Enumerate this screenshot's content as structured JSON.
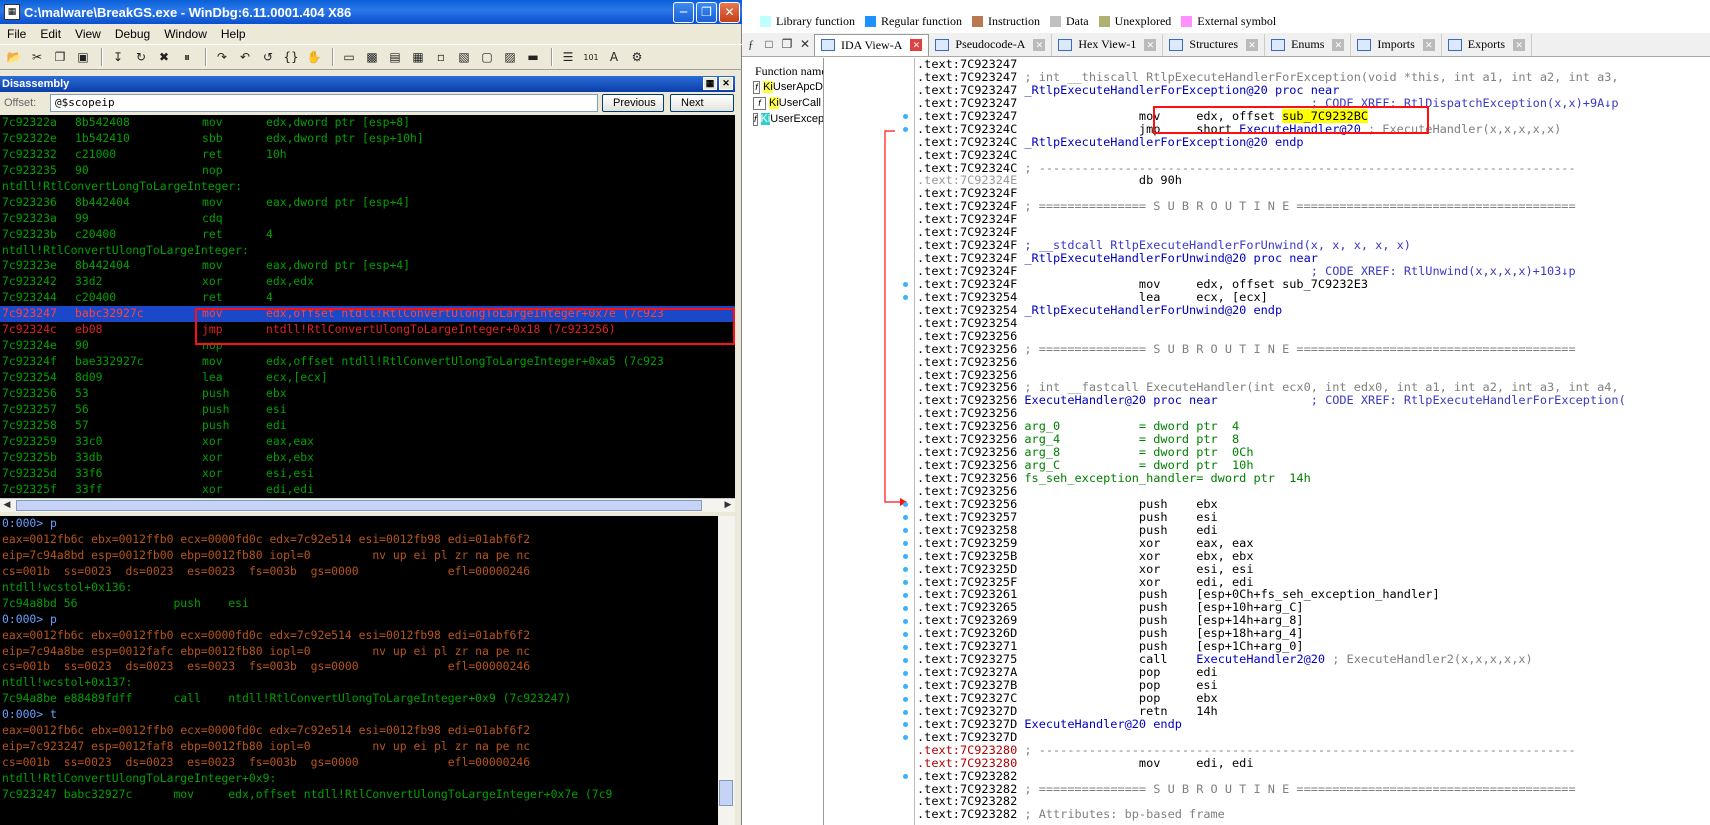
{
  "windbg": {
    "title": "C:\\malware\\BreakGS.exe - WinDbg:6.11.0001.404 X86",
    "menu": [
      "File",
      "Edit",
      "View",
      "Debug",
      "Window",
      "Help"
    ],
    "pane_title": "Disassembly",
    "offset_label": "Offset:",
    "offset_value": "@$scopeip",
    "previous_label": "Previous",
    "next_label": "Next",
    "disasm": [
      {
        "addr": "7c92322a",
        "bytes": "8b542408",
        "op": "mov",
        "args": "edx,dword ptr [esp+8]"
      },
      {
        "addr": "7c92322e",
        "bytes": "1b542410",
        "op": "sbb",
        "args": "edx,dword ptr [esp+10h]"
      },
      {
        "addr": "7c923232",
        "bytes": "c21000",
        "op": "ret",
        "args": "10h"
      },
      {
        "addr": "7c923235",
        "bytes": "90",
        "op": "nop",
        "args": ""
      },
      {
        "label": "ntdll!RtlConvertLongToLargeInteger:"
      },
      {
        "addr": "7c923236",
        "bytes": "8b442404",
        "op": "mov",
        "args": "eax,dword ptr [esp+4]"
      },
      {
        "addr": "7c92323a",
        "bytes": "99",
        "op": "cdq",
        "args": ""
      },
      {
        "addr": "7c92323b",
        "bytes": "c20400",
        "op": "ret",
        "args": "4"
      },
      {
        "label": "ntdll!RtlConvertUlongToLargeInteger:"
      },
      {
        "addr": "7c92323e",
        "bytes": "8b442404",
        "op": "mov",
        "args": "eax,dword ptr [esp+4]"
      },
      {
        "addr": "7c923242",
        "bytes": "33d2",
        "op": "xor",
        "args": "edx,edx"
      },
      {
        "addr": "7c923244",
        "bytes": "c20400",
        "op": "ret",
        "args": "4"
      },
      {
        "addr": "7c923247",
        "bytes": "babc32927c",
        "op": "mov",
        "args": "edx,offset ntdll!RtlConvertUlongToLargeInteger+0x7e (7c923",
        "style": "hl"
      },
      {
        "addr": "7c92324c",
        "bytes": "eb08",
        "op": "jmp",
        "args": "ntdll!RtlConvertUlongToLargeInteger+0x18 (7c923256)",
        "style": "sel"
      },
      {
        "addr": "7c92324e",
        "bytes": "90",
        "op": "nop",
        "args": ""
      },
      {
        "addr": "7c92324f",
        "bytes": "bae332927c",
        "op": "mov",
        "args": "edx,offset ntdll!RtlConvertUlongToLargeInteger+0xa5 (7c923"
      },
      {
        "addr": "7c923254",
        "bytes": "8d09",
        "op": "lea",
        "args": "ecx,[ecx]"
      },
      {
        "addr": "7c923256",
        "bytes": "53",
        "op": "push",
        "args": "ebx"
      },
      {
        "addr": "7c923257",
        "bytes": "56",
        "op": "push",
        "args": "esi"
      },
      {
        "addr": "7c923258",
        "bytes": "57",
        "op": "push",
        "args": "edi"
      },
      {
        "addr": "7c923259",
        "bytes": "33c0",
        "op": "xor",
        "args": "eax,eax"
      },
      {
        "addr": "7c92325b",
        "bytes": "33db",
        "op": "xor",
        "args": "ebx,ebx"
      },
      {
        "addr": "7c92325d",
        "bytes": "33f6",
        "op": "xor",
        "args": "esi,esi"
      },
      {
        "addr": "7c92325f",
        "bytes": "33ff",
        "op": "xor",
        "args": "edi,edi"
      }
    ],
    "command": [
      {
        "t": "0:000> p",
        "s": "prompt"
      },
      {
        "t": "eax=0012fb6c ebx=0012ffb0 ecx=0000fd0c edx=7c92e514 esi=0012fb98 edi=01abf6f2"
      },
      {
        "t": "eip=7c94a8bd esp=0012fb00 ebp=0012fb80 iopl=0         nv up ei pl zr na pe nc"
      },
      {
        "t": "cs=001b  ss=0023  ds=0023  es=0023  fs=003b  gs=0000             efl=00000246"
      },
      {
        "t": "ntdll!wcstol+0x136:",
        "s": "g"
      },
      {
        "t": "7c94a8bd 56              push    esi",
        "s": "g"
      },
      {
        "t": "0:000> p",
        "s": "prompt"
      },
      {
        "t": "eax=0012fb6c ebx=0012ffb0 ecx=0000fd0c edx=7c92e514 esi=0012fb98 edi=01abf6f2"
      },
      {
        "t": "eip=7c94a8be esp=0012fafc ebp=0012fb80 iopl=0         nv up ei pl zr na pe nc"
      },
      {
        "t": "cs=001b  ss=0023  ds=0023  es=0023  fs=003b  gs=0000             efl=00000246"
      },
      {
        "t": "ntdll!wcstol+0x137:",
        "s": "g"
      },
      {
        "t": "7c94a8be e88489fdff      call    ntdll!RtlConvertUlongToLargeInteger+0x9 (7c923247)",
        "s": "g"
      },
      {
        "t": "0:000> t",
        "s": "prompt"
      },
      {
        "t": "eax=0012fb6c ebx=0012ffb0 ecx=0000fd0c edx=7c92e514 esi=0012fb98 edi=01abf6f2"
      },
      {
        "t": "eip=7c923247 esp=0012faf8 ebp=0012fb80 iopl=0         nv up ei pl zr na pe nc"
      },
      {
        "t": "cs=001b  ss=0023  ds=0023  es=0023  fs=003b  gs=0000             efl=00000246"
      },
      {
        "t": "ntdll!RtlConvertUlongToLargeInteger+0x9:",
        "s": "g"
      },
      {
        "t": "7c923247 babc32927c      mov     edx,offset ntdll!RtlConvertUlongToLargeInteger+0x7e (7c9",
        "s": "g"
      }
    ]
  },
  "ida": {
    "legend": [
      {
        "label": "Library function",
        "color": "#c0ffff"
      },
      {
        "label": "Regular function",
        "color": "#1e90ff"
      },
      {
        "label": "Instruction",
        "color": "#b87850"
      },
      {
        "label": "Data",
        "color": "#c0c0c0"
      },
      {
        "label": "Unexplored",
        "color": "#b0b070"
      },
      {
        "label": "External symbol",
        "color": "#ff90ff"
      }
    ],
    "tabs": [
      "IDA View-A",
      "Pseudocode-A",
      "Hex View-1",
      "Structures",
      "Enums",
      "Imports",
      "Exports"
    ],
    "function_header": "Function name",
    "functions": [
      {
        "prefix": "Ki",
        "rest": "UserApcD"
      },
      {
        "prefix": "Ki",
        "rest": "UserCall"
      },
      {
        "prefix": "Ki",
        "rest": "UserExcep"
      }
    ],
    "lines": [
      {
        "a": ".text:7C923247",
        "p": []
      },
      {
        "a": ".text:7C923247",
        "p": [
          {
            "c": "cmt",
            "t": " ; int __thiscall RtlpExecuteHandlerForException(void *this, int a1, int a2, int a3,"
          }
        ]
      },
      {
        "a": ".text:7C923247",
        "p": [
          {
            "c": "fnm",
            "t": " _RtlpExecuteHandlerForException@20 proc near"
          }
        ]
      },
      {
        "a": ".text:7C923247",
        "p": [
          {
            "c": "",
            "t": "                                         "
          },
          {
            "c": "cmtb",
            "t": "; CODE XREF: RtlDispatchException(x,x)+9A↓p"
          }
        ]
      },
      {
        "a": ".text:7C923247",
        "p": [
          {
            "c": "",
            "t": "                 mov     edx, offset "
          },
          {
            "c": "yl",
            "t": "sub_7C9232BC"
          }
        ]
      },
      {
        "a": ".text:7C92324C",
        "p": [
          {
            "c": "",
            "t": "                 jmp     short "
          },
          {
            "c": "fnm",
            "t": "ExecuteHandler@20"
          },
          {
            "c": "cmt",
            "t": " ; ExecuteHandler(x,x,x,x,x)"
          }
        ]
      },
      {
        "a": ".text:7C92324C",
        "p": [
          {
            "c": "fnm",
            "t": " _RtlpExecuteHandlerForException@20 endp"
          }
        ]
      },
      {
        "a": ".text:7C92324C",
        "p": []
      },
      {
        "a": ".text:7C92324C",
        "p": [
          {
            "c": "sep",
            "t": " ; ---------------------------------------------------------------------------"
          }
        ]
      },
      {
        "a": ".text:7C92324E",
        "s": "gray",
        "p": [
          {
            "c": "",
            "t": "                 db 90h"
          }
        ]
      },
      {
        "a": ".text:7C92324F",
        "p": []
      },
      {
        "a": ".text:7C92324F",
        "p": [
          {
            "c": "sep",
            "t": " ; =============== S U B R O U T I N E ======================================="
          }
        ]
      },
      {
        "a": ".text:7C92324F",
        "p": []
      },
      {
        "a": ".text:7C92324F",
        "p": []
      },
      {
        "a": ".text:7C92324F",
        "p": [
          {
            "c": "cmtb",
            "t": " ; __stdcall RtlpExecuteHandlerForUnwind(x, x, x, x, x)"
          }
        ]
      },
      {
        "a": ".text:7C92324F",
        "p": [
          {
            "c": "fnm",
            "t": " _RtlpExecuteHandlerForUnwind@20 proc near"
          }
        ]
      },
      {
        "a": ".text:7C92324F",
        "p": [
          {
            "c": "",
            "t": "                                         "
          },
          {
            "c": "cmtb",
            "t": "; CODE XREF: RtlUnwind(x,x,x,x)+103↓p"
          }
        ]
      },
      {
        "a": ".text:7C92324F",
        "p": [
          {
            "c": "",
            "t": "                 mov     edx, offset sub_7C9232E3"
          }
        ]
      },
      {
        "a": ".text:7C923254",
        "p": [
          {
            "c": "",
            "t": "                 lea     ecx, [ecx]"
          }
        ]
      },
      {
        "a": ".text:7C923254",
        "p": [
          {
            "c": "fnm",
            "t": " _RtlpExecuteHandlerForUnwind@20 endp"
          }
        ]
      },
      {
        "a": ".text:7C923254",
        "p": []
      },
      {
        "a": ".text:7C923256",
        "p": []
      },
      {
        "a": ".text:7C923256",
        "p": [
          {
            "c": "sep",
            "t": " ; =============== S U B R O U T I N E ======================================="
          }
        ]
      },
      {
        "a": ".text:7C923256",
        "p": []
      },
      {
        "a": ".text:7C923256",
        "p": []
      },
      {
        "a": ".text:7C923256",
        "p": [
          {
            "c": "cmt",
            "t": " ; int __fastcall ExecuteHandler(int ecx0, int edx0, int a1, int a2, int a3, int a4,"
          }
        ]
      },
      {
        "a": ".text:7C923256",
        "p": [
          {
            "c": "fnm",
            "t": " ExecuteHandler@20 proc near"
          },
          {
            "c": "",
            "t": "             "
          },
          {
            "c": "cmtb",
            "t": "; CODE XREF: RtlpExecuteHandlerForException("
          }
        ]
      },
      {
        "a": ".text:7C923256",
        "p": []
      },
      {
        "a": ".text:7C923256",
        "p": [
          {
            "c": "grn",
            "t": " arg_0           = dword ptr  4"
          }
        ]
      },
      {
        "a": ".text:7C923256",
        "p": [
          {
            "c": "grn",
            "t": " arg_4           = dword ptr  8"
          }
        ]
      },
      {
        "a": ".text:7C923256",
        "p": [
          {
            "c": "grn",
            "t": " arg_8           = dword ptr  0Ch"
          }
        ]
      },
      {
        "a": ".text:7C923256",
        "p": [
          {
            "c": "grn",
            "t": " arg_C           = dword ptr  10h"
          }
        ]
      },
      {
        "a": ".text:7C923256",
        "p": [
          {
            "c": "grn",
            "t": " fs_seh_exception_handler= dword ptr  14h"
          }
        ]
      },
      {
        "a": ".text:7C923256",
        "p": []
      },
      {
        "a": ".text:7C923256",
        "p": [
          {
            "c": "",
            "t": "                 push    ebx"
          }
        ]
      },
      {
        "a": ".text:7C923257",
        "p": [
          {
            "c": "",
            "t": "                 push    esi"
          }
        ]
      },
      {
        "a": ".text:7C923258",
        "p": [
          {
            "c": "",
            "t": "                 push    edi"
          }
        ]
      },
      {
        "a": ".text:7C923259",
        "p": [
          {
            "c": "",
            "t": "                 xor     eax, eax"
          }
        ]
      },
      {
        "a": ".text:7C92325B",
        "p": [
          {
            "c": "",
            "t": "                 xor     ebx, ebx"
          }
        ]
      },
      {
        "a": ".text:7C92325D",
        "p": [
          {
            "c": "",
            "t": "                 xor     esi, esi"
          }
        ]
      },
      {
        "a": ".text:7C92325F",
        "p": [
          {
            "c": "",
            "t": "                 xor     edi, edi"
          }
        ]
      },
      {
        "a": ".text:7C923261",
        "p": [
          {
            "c": "",
            "t": "                 push    [esp+0Ch+fs_seh_exception_handler]"
          }
        ]
      },
      {
        "a": ".text:7C923265",
        "p": [
          {
            "c": "",
            "t": "                 push    [esp+10h+arg_C]"
          }
        ]
      },
      {
        "a": ".text:7C923269",
        "p": [
          {
            "c": "",
            "t": "                 push    [esp+14h+arg_8]"
          }
        ]
      },
      {
        "a": ".text:7C92326D",
        "p": [
          {
            "c": "",
            "t": "                 push    [esp+18h+arg_4]"
          }
        ]
      },
      {
        "a": ".text:7C923271",
        "p": [
          {
            "c": "",
            "t": "                 push    [esp+1Ch+arg_0]"
          }
        ]
      },
      {
        "a": ".text:7C923275",
        "p": [
          {
            "c": "",
            "t": "                 call    "
          },
          {
            "c": "fnm",
            "t": "ExecuteHandler2@20"
          },
          {
            "c": "cmt",
            "t": " ; ExecuteHandler2(x,x,x,x,x)"
          }
        ]
      },
      {
        "a": ".text:7C92327A",
        "p": [
          {
            "c": "",
            "t": "                 pop     edi"
          }
        ]
      },
      {
        "a": ".text:7C92327B",
        "p": [
          {
            "c": "",
            "t": "                 pop     esi"
          }
        ]
      },
      {
        "a": ".text:7C92327C",
        "p": [
          {
            "c": "",
            "t": "                 pop     ebx"
          }
        ]
      },
      {
        "a": ".text:7C92327D",
        "p": [
          {
            "c": "",
            "t": "                 retn    14h"
          }
        ]
      },
      {
        "a": ".text:7C92327D",
        "p": [
          {
            "c": "fnm",
            "t": " ExecuteHandler@20 endp"
          }
        ]
      },
      {
        "a": ".text:7C92327D",
        "p": []
      },
      {
        "a": ".text:7C923280",
        "s": "red",
        "p": [
          {
            "c": "sep",
            "t": " ; ---------------------------------------------------------------------------"
          }
        ]
      },
      {
        "a": ".text:7C923280",
        "s": "red",
        "p": [
          {
            "c": "",
            "t": "                 mov     edi, edi"
          }
        ]
      },
      {
        "a": ".text:7C923282",
        "p": []
      },
      {
        "a": ".text:7C923282",
        "p": [
          {
            "c": "sep",
            "t": " ; =============== S U B R O U T I N E ======================================="
          }
        ]
      },
      {
        "a": ".text:7C923282",
        "p": []
      },
      {
        "a": ".text:7C923282",
        "p": [
          {
            "c": "cmt",
            "t": " ; Attributes: bp-based frame"
          }
        ]
      }
    ]
  }
}
